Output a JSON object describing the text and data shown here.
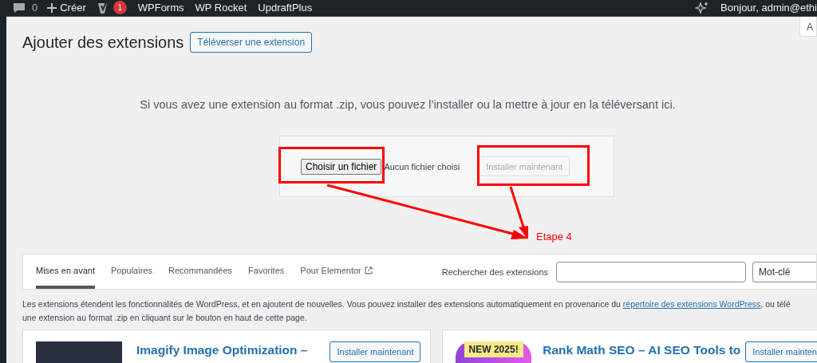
{
  "admin_bar": {
    "comments_count": "0",
    "new_label": "Créer",
    "seo_badge": "1",
    "links": [
      "WPForms",
      "WP Rocket",
      "UpdraftPlus"
    ],
    "greeting": "Bonjour, admin@ethi"
  },
  "screen_options": "A",
  "page": {
    "title": "Ajouter des extensions",
    "upload_button": "Téléverser une extension"
  },
  "upload": {
    "hint": "Si vous avez une extension au format .zip, vous pouvez l’installer ou la mettre à jour en la téléversant ici.",
    "file_button": "Choisir un fichier",
    "file_status": "Aucun fichier choisi",
    "install_button": {
      "label": "Installer maintenant",
      "disabled": true
    }
  },
  "annotation": {
    "label": "Etape 4"
  },
  "tabs": [
    {
      "label": "Mises en avant",
      "selected": true,
      "external": false
    },
    {
      "label": "Populaires",
      "selected": false,
      "external": false
    },
    {
      "label": "Recommandées",
      "selected": false,
      "external": false
    },
    {
      "label": "Favorites",
      "selected": false,
      "external": false
    },
    {
      "label": "Pour Elementor",
      "selected": false,
      "external": true
    }
  ],
  "search": {
    "label": "Rechercher des extensions",
    "type_select": "Mot-clé"
  },
  "description": {
    "before": "Les extensions étendent les fonctionnalités de WordPress, et en ajoutent de nouvelles. Vous pouvez installer des extensions automatiquement en provenance du ",
    "link": "répertoire des extensions WordPress",
    "after": ", ou télé",
    "line2": "une extension au format .zip en cliquant sur le bouton en haut de cette page."
  },
  "plugins": [
    {
      "title": "Imagify Image Optimization –",
      "button": "Installer maintenant",
      "kind": "dark"
    },
    {
      "title": "Rank Math SEO – AI SEO Tools to",
      "button": "Installer mainten",
      "kind": "badge",
      "badge": "NEW 2025!"
    }
  ]
}
